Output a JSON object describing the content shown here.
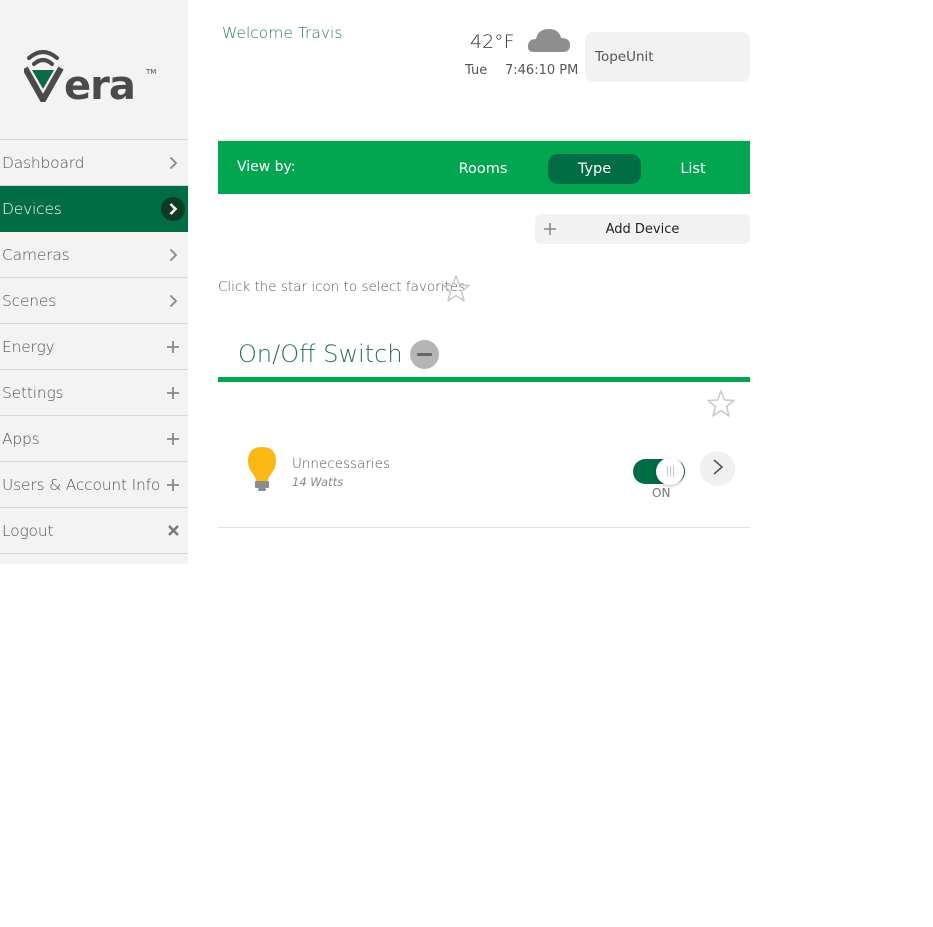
{
  "brand": {
    "name": "vera",
    "trademark": "TM",
    "accent": "#016d45",
    "green": "#02a650"
  },
  "sidebar": {
    "items": [
      {
        "label": "Dashboard",
        "icon": "chevron-right-icon",
        "active": false
      },
      {
        "label": "Devices",
        "icon": "chevron-right-icon",
        "active": true
      },
      {
        "label": "Cameras",
        "icon": "chevron-right-icon",
        "active": false
      },
      {
        "label": "Scenes",
        "icon": "chevron-right-icon",
        "active": false
      },
      {
        "label": "Energy",
        "icon": "plus-icon",
        "active": false
      },
      {
        "label": "Settings",
        "icon": "plus-icon",
        "active": false
      },
      {
        "label": "Apps",
        "icon": "plus-icon",
        "active": false
      },
      {
        "label": "Users & Account Info",
        "icon": "plus-icon",
        "active": false
      },
      {
        "label": "Logout",
        "icon": "close-icon",
        "active": false
      }
    ]
  },
  "header": {
    "welcome": "Welcome Travis",
    "weather": {
      "temperature": "42°F",
      "condition_icon": "cloud-icon"
    },
    "day": "Tue",
    "time": "7:46:10 PM",
    "unit_name": "TopeUnit"
  },
  "view_by": {
    "label": "View by:",
    "tabs": [
      {
        "label": "Rooms",
        "selected": false
      },
      {
        "label": "Type",
        "selected": true
      },
      {
        "label": "List",
        "selected": false
      }
    ]
  },
  "add_device": {
    "label": "Add Device"
  },
  "favorites_hint": "Click the star icon to select favorites",
  "category": {
    "title": "On/Off Switch",
    "devices": [
      {
        "name": "Unnecessaries",
        "power": "14 Watts",
        "state": "ON",
        "on": true,
        "icon": "light-bulb-icon"
      }
    ]
  }
}
